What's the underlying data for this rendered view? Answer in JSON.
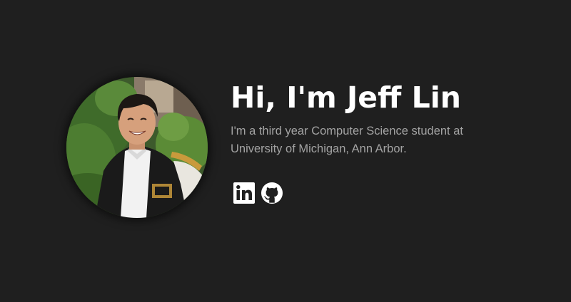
{
  "profile": {
    "name_heading": "Hi, I'm Jeff Lin",
    "bio": "I'm a third year Computer Science student at University of Michigan, Ann Arbor.",
    "photo_alt": "Jeff Lin"
  },
  "socials": [
    {
      "label": "LinkedIn",
      "icon": "linkedin-icon"
    },
    {
      "label": "GitHub",
      "icon": "github-icon"
    }
  ],
  "colors": {
    "background": "#1f1f1f",
    "heading": "#ffffff",
    "bio_text": "#a3a3a3",
    "icon": "#ffffff"
  }
}
